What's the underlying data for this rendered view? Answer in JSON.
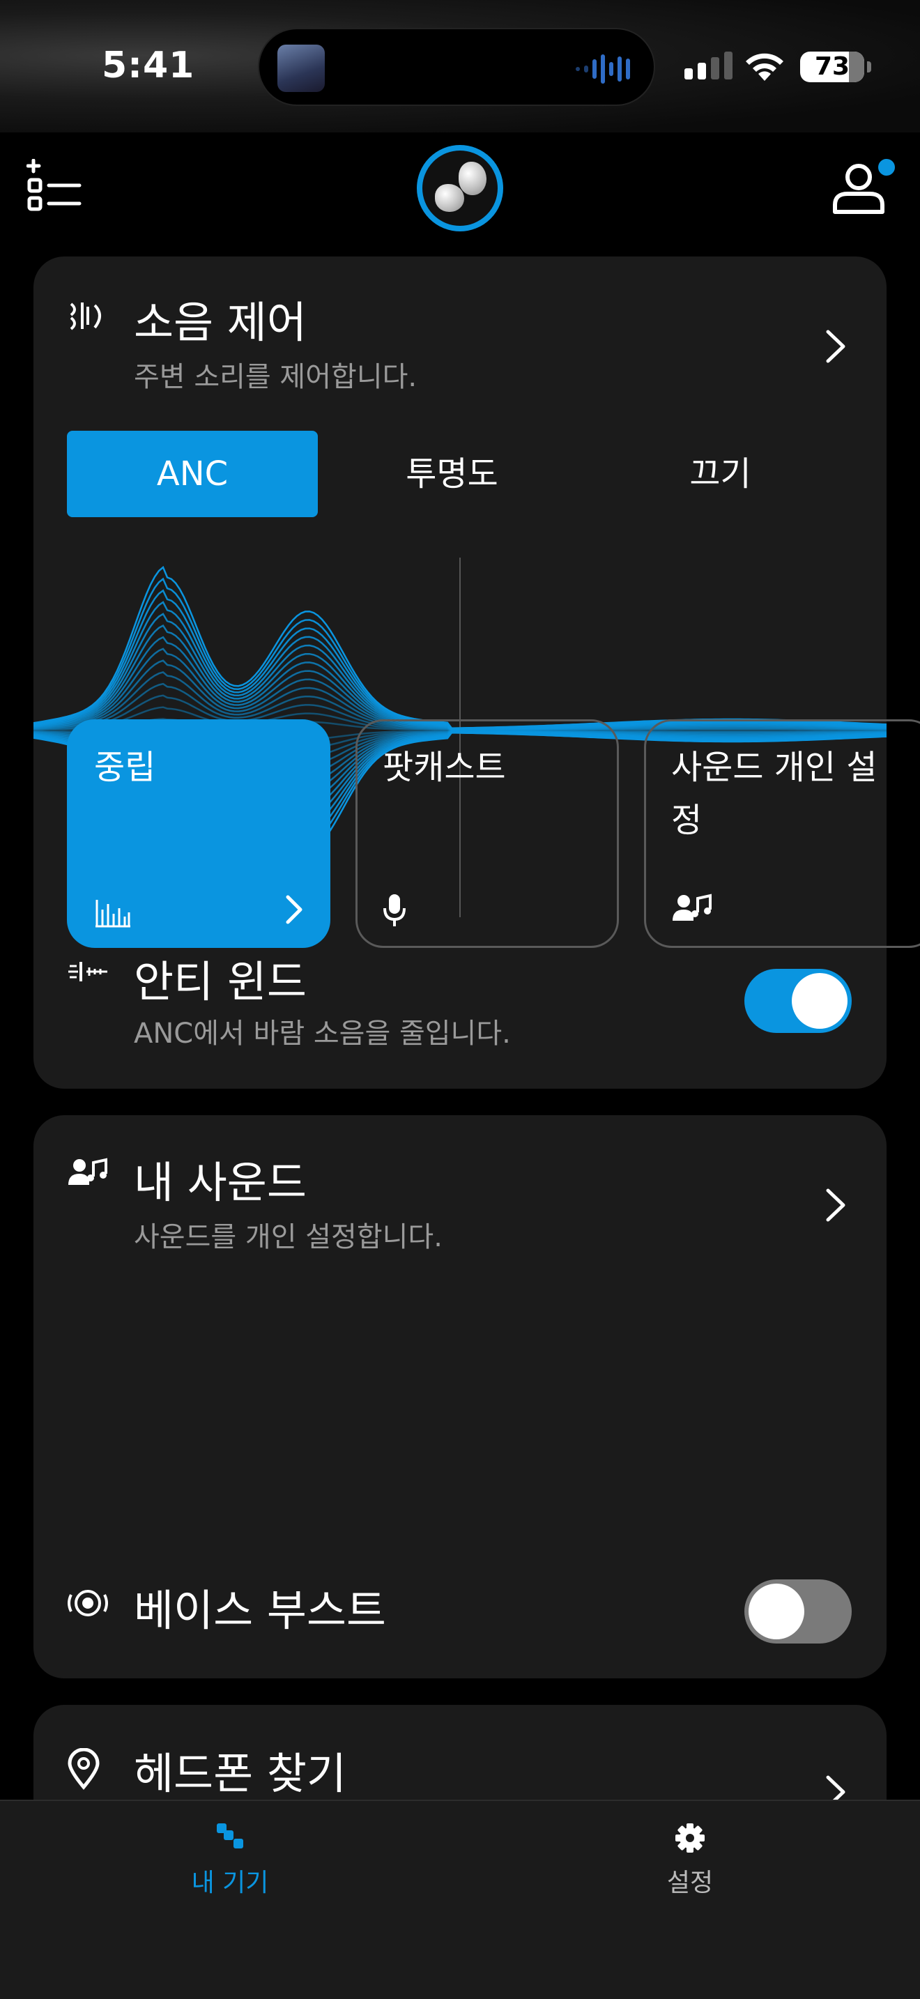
{
  "status_bar": {
    "time": "5:41",
    "battery": "73"
  },
  "noise_control": {
    "title": "소음 제어",
    "subtitle": "주변 소리를 제어합니다.",
    "modes": [
      "ANC",
      "투명도",
      "끄기"
    ],
    "selected_mode": "ANC"
  },
  "anti_wind": {
    "title": "안티 윈드",
    "subtitle": "ANC에서 바람 소음을 줄입니다.",
    "enabled": true
  },
  "my_sound": {
    "title": "내 사운드",
    "subtitle": "사운드를 개인 설정합니다.",
    "presets": [
      "중립",
      "팟캐스트",
      "사운드 개인 설정"
    ],
    "selected_preset": "중립"
  },
  "bass_boost": {
    "title": "베이스 부스트",
    "enabled": false
  },
  "find_headphones": {
    "title": "헤드폰 찾기"
  },
  "nav": {
    "devices": "내 기기",
    "settings": "설정"
  },
  "colors": {
    "accent": "#0A95E0",
    "card": "#1B1B1B",
    "background": "#000000"
  }
}
